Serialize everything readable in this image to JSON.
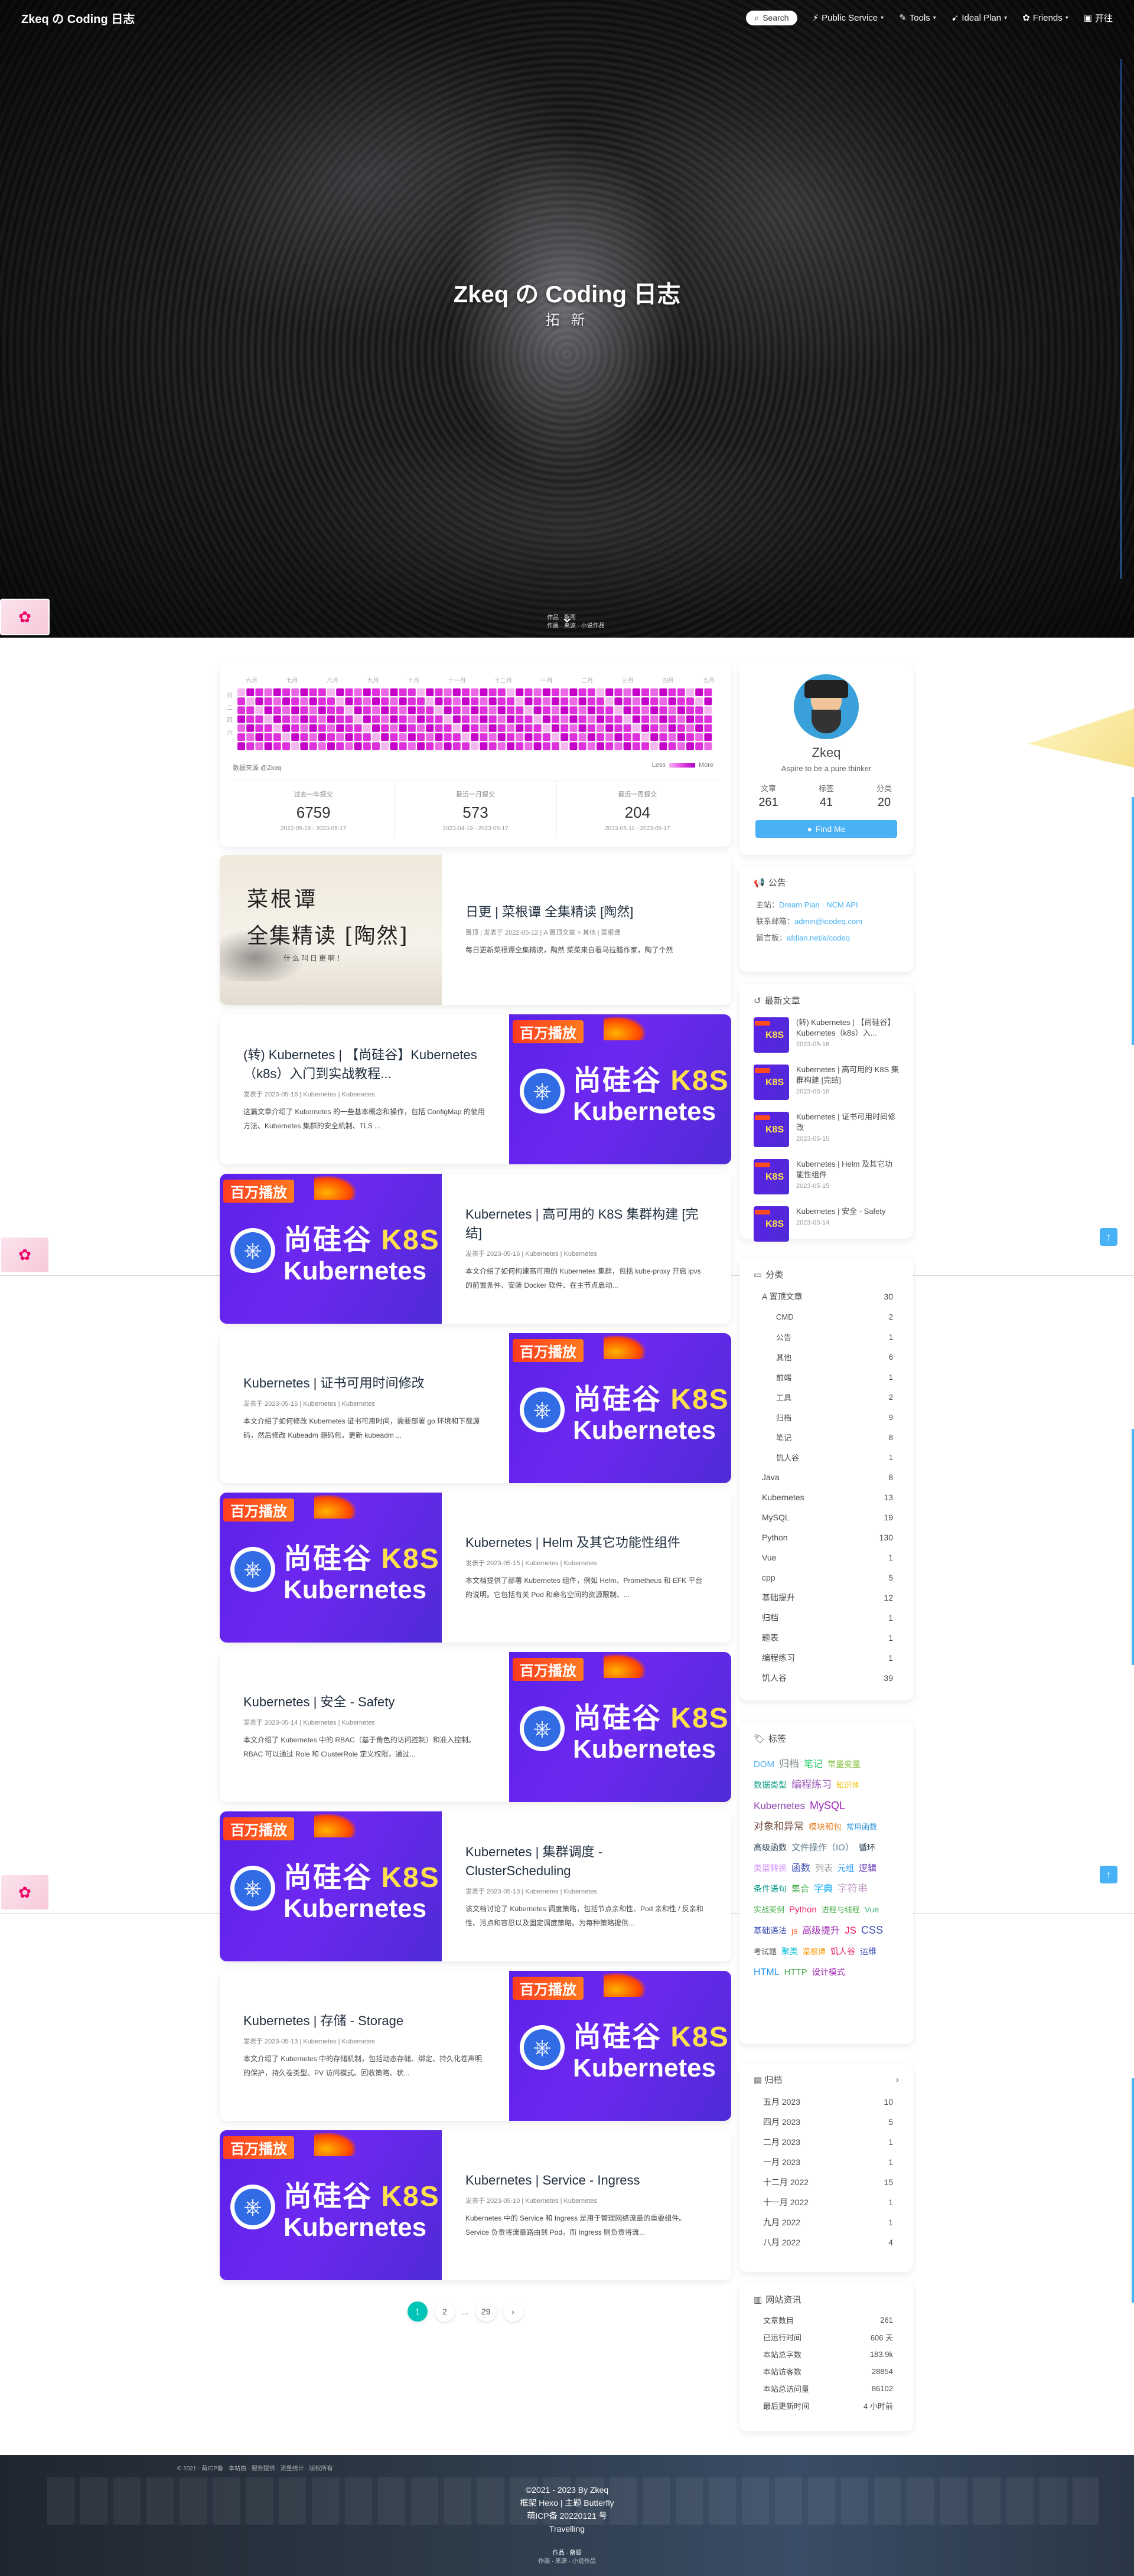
{
  "nav": {
    "title": "Zkeq の Coding 日志",
    "search_label": "Search",
    "menus": [
      "Public Service",
      "Tools",
      "Ideal Plan",
      "Friends",
      "开往"
    ]
  },
  "hero": {
    "title": "Zkeq の Coding 日志",
    "subtitle": "拓 新",
    "scroll_hint": "作品 · 蔡阁",
    "scroll_hint2": "作画 · 来源 · 小说作品"
  },
  "heatmap": {
    "months": [
      "六月",
      "七月",
      "八月",
      "九月",
      "十月",
      "十一月",
      "十二月",
      "一月",
      "二月",
      "三月",
      "四月",
      "五月"
    ],
    "weekdays": [
      "日",
      "二",
      "四",
      "六"
    ],
    "source": "数据来源 @Zkeq",
    "legend_less": "Less",
    "legend_more": "More",
    "stats": [
      {
        "label": "过去一年提交",
        "value": "6759",
        "range": "2022-05-19 - 2023-05-17"
      },
      {
        "label": "最近一月提交",
        "value": "573",
        "range": "2023-04-19 - 2023-05-17"
      },
      {
        "label": "最近一周提交",
        "value": "204",
        "range": "2023-05-11 - 2023-05-17"
      }
    ]
  },
  "posts": [
    {
      "title": "日更 | 菜根谭 全集精读 [陶然]",
      "meta": "置顶 | 发表于 2022-05-12 | A 置顶文章 > 其他 | 菜根谭",
      "excerpt": "每日更新菜根谭全集精读，陶然 菜菜来自看马拉腊作家，陶了个然"
    },
    {
      "title": "(转) Kubernetes | 【尚硅谷】Kubernetes（k8s）入门到实战教程...",
      "meta": "发表于 2023-05-16 | Kubernetes | Kubernetes",
      "excerpt": "这篇文章介绍了 Kubernetes 的一些基本概念和操作，包括 ConfigMap 的使用方法、Kubernetes 集群的安全机制、TLS ..."
    },
    {
      "title": "Kubernetes | 高可用的 K8S 集群构建 [完结]",
      "meta": "发表于 2023-05-16 | Kubernetes | Kubernetes",
      "excerpt": "本文介绍了如何构建高可用的 Kubernetes 集群，包括 kube-proxy 开启 ipvs 的前置条件、安装 Docker 软件、在主节点启动..."
    },
    {
      "title": "Kubernetes | 证书可用时间修改",
      "meta": "发表于 2023-05-15 | Kubernetes | Kubernetes",
      "excerpt": "本文介绍了如何修改 Kubernetes 证书可用时间，需要部署 go 环境和下载源码，然后修改 Kubeadm 源码包，更新 kubeadm ..."
    },
    {
      "title": "Kubernetes | Helm 及其它功能性组件",
      "meta": "发表于 2023-05-15 | Kubernetes | Kubernetes",
      "excerpt": "本文档提供了部署 Kubernetes 组件，例如 Helm、Prometheus 和 EFK 平台的说明。它包括有关 Pod 和命名空间的资源限制、..."
    },
    {
      "title": "Kubernetes | 安全 - Safety",
      "meta": "发表于 2023-05-14 | Kubernetes | Kubernetes",
      "excerpt": "本文介绍了 Kubernetes 中的 RBAC（基于角色的访问控制）和准入控制。RBAC 可以通过 Role 和 ClusterRole 定义权限，通过..."
    },
    {
      "title": "Kubernetes | 集群调度 - ClusterScheduling",
      "meta": "发表于 2023-05-13 | Kubernetes | Kubernetes",
      "excerpt": "该文档讨论了 Kubernetes 调度策略，包括节点亲和性、Pod 亲和性 / 反亲和性、污点和容忍以及固定调度策略。为每种策略提供..."
    },
    {
      "title": "Kubernetes | 存储 - Storage",
      "meta": "发表于 2023-05-13 | Kubernetes | Kubernetes",
      "excerpt": "本文介绍了 Kubernetes 中的存储机制，包括动态存储、绑定、持久化卷声明的保护，持久卷类型、PV 访问模式、回收策略、状..."
    },
    {
      "title": "Kubernetes | Service - Ingress",
      "meta": "发表于 2023-05-10 | Kubernetes | Kubernetes",
      "excerpt": "Kubernetes 中的 Service 和 Ingress 是用于管理网络流量的重要组件。Service 负责将流量路由到 Pod，而 Ingress 则负责将流..."
    }
  ],
  "k8s_thumb": {
    "badge": "百万播放",
    "line1a": "尚硅谷 ",
    "line1b": "K8S",
    "line2": "Kubernetes"
  },
  "cai_thumb": {
    "line1": "菜根谭",
    "line2": "全集精读 [陶然]",
    "line3": "什么叫日更啊！"
  },
  "pagination": {
    "pages": [
      "1",
      "2",
      "...",
      "29",
      "›"
    ]
  },
  "author": {
    "name": "Zkeq",
    "desc": "Aspire to be a pure thinker",
    "counts": [
      {
        "label": "文章",
        "value": "261"
      },
      {
        "label": "标签",
        "value": "41"
      },
      {
        "label": "分类",
        "value": "20"
      }
    ],
    "follow": "Find Me"
  },
  "announce": {
    "title": "公告",
    "lines": [
      {
        "label": "主站：",
        "value": "Dream Plan · NCM API"
      },
      {
        "label": "联系邮箱：",
        "value": "admin@icodeq.com"
      },
      {
        "label": "留言板：",
        "value": "afdian.net/a/codeq"
      }
    ]
  },
  "recent": {
    "title": "最新文章",
    "items": [
      {
        "title": "(转) Kubernetes | 【尚硅谷】Kubernetes（k8s）入...",
        "date": "2023-05-16"
      },
      {
        "title": "Kubernetes | 高可用的 K8S 集群构建 [完结]",
        "date": "2023-05-16"
      },
      {
        "title": "Kubernetes | 证书可用时间修改",
        "date": "2023-05-15"
      },
      {
        "title": "Kubernetes | Helm 及其它功能性组件",
        "date": "2023-05-15"
      },
      {
        "title": "Kubernetes | 安全 - Safety",
        "date": "2023-05-14"
      }
    ]
  },
  "categories": {
    "title": "分类",
    "items": [
      {
        "name": "A 置顶文章",
        "count": "30",
        "child": false
      },
      {
        "name": "CMD",
        "count": "2",
        "child": true
      },
      {
        "name": "公告",
        "count": "1",
        "child": true
      },
      {
        "name": "其他",
        "count": "6",
        "child": true
      },
      {
        "name": "前端",
        "count": "1",
        "child": true
      },
      {
        "name": "工具",
        "count": "2",
        "child": true
      },
      {
        "name": "归档",
        "count": "9",
        "child": true
      },
      {
        "name": "笔记",
        "count": "8",
        "child": true
      },
      {
        "name": "饥人谷",
        "count": "1",
        "child": true
      },
      {
        "name": "Java",
        "count": "8",
        "child": false
      },
      {
        "name": "Kubernetes",
        "count": "13",
        "child": false
      },
      {
        "name": "MySQL",
        "count": "19",
        "child": false
      },
      {
        "name": "Python",
        "count": "130",
        "child": false
      },
      {
        "name": "Vue",
        "count": "1",
        "child": false
      },
      {
        "name": "cpp",
        "count": "5",
        "child": false
      },
      {
        "name": "基础提升",
        "count": "12",
        "child": false
      },
      {
        "name": "归档",
        "count": "1",
        "child": false
      },
      {
        "name": "题表",
        "count": "1",
        "child": false
      },
      {
        "name": "编程练习",
        "count": "1",
        "child": false
      },
      {
        "name": "饥人谷",
        "count": "39",
        "child": false
      }
    ]
  },
  "tags": {
    "title": "标签",
    "items": [
      {
        "t": "DOM",
        "c": "#49b1f5",
        "s": "15px"
      },
      {
        "t": "归档",
        "c": "#7f8c8d",
        "s": "17px"
      },
      {
        "t": "笔记",
        "c": "#2ecc71",
        "s": "16px"
      },
      {
        "t": "常量变量",
        "c": "#8bc34a",
        "s": "14px"
      },
      {
        "t": "数据类型",
        "c": "#16a085",
        "s": "14px"
      },
      {
        "t": "编程练习",
        "c": "#9b59b6",
        "s": "17px"
      },
      {
        "t": "知识体",
        "c": "#f1c40f",
        "s": "13px"
      },
      {
        "t": "Kubernetes",
        "c": "#8e44ad",
        "s": "17px"
      },
      {
        "t": "MySQL",
        "c": "#9c27b0",
        "s": "18px"
      },
      {
        "t": "对象和异常",
        "c": "#795548",
        "s": "17px"
      },
      {
        "t": "模块和包",
        "c": "#e67e22",
        "s": "14px"
      },
      {
        "t": "常用函数",
        "c": "#3498db",
        "s": "13px"
      },
      {
        "t": "高级函数",
        "c": "#34495e",
        "s": "14px"
      },
      {
        "t": "文件操作（IO）",
        "c": "#607d8b",
        "s": "15px"
      },
      {
        "t": "循环",
        "c": "#2c3e50",
        "s": "14px"
      },
      {
        "t": "类型转换",
        "c": "#d291ff",
        "s": "14px"
      },
      {
        "t": "函数",
        "c": "#3f51b5",
        "s": "16px"
      },
      {
        "t": "列表",
        "c": "#9e9e9e",
        "s": "15px"
      },
      {
        "t": "元组",
        "c": "#2196f3",
        "s": "14px"
      },
      {
        "t": "逻辑",
        "c": "#673ab7",
        "s": "15px"
      },
      {
        "t": "条件语句",
        "c": "#009688",
        "s": "14px"
      },
      {
        "t": "集合",
        "c": "#4caf50",
        "s": "15px"
      },
      {
        "t": "字典",
        "c": "#03a9f4",
        "s": "16px"
      },
      {
        "t": "字符串",
        "c": "#c5a3c8",
        "s": "17px"
      },
      {
        "t": "实战案例",
        "c": "#4caf50",
        "s": "13px"
      },
      {
        "t": "Python",
        "c": "#e91e63",
        "s": "15px"
      },
      {
        "t": "进程与线程",
        "c": "#4caf50",
        "s": "13px"
      },
      {
        "t": "Vue",
        "c": "#42b983",
        "s": "14px"
      },
      {
        "t": "基础语法",
        "c": "#3f51b5",
        "s": "14px"
      },
      {
        "t": "js",
        "c": "#ff5722",
        "s": "14px"
      },
      {
        "t": "高级提升",
        "c": "#9c27b0",
        "s": "16px"
      },
      {
        "t": "JS",
        "c": "#e91e63",
        "s": "17px"
      },
      {
        "t": "CSS",
        "c": "#3f51b5",
        "s": "18px"
      },
      {
        "t": "考试题",
        "c": "#555555",
        "s": "13px"
      },
      {
        "t": "聚类",
        "c": "#00bcd4",
        "s": "14px"
      },
      {
        "t": "菜根谭",
        "c": "#ff9800",
        "s": "13px"
      },
      {
        "t": "饥人谷",
        "c": "#e91e63",
        "s": "14px"
      },
      {
        "t": "运维",
        "c": "#3f51b5",
        "s": "14px"
      },
      {
        "t": "HTML",
        "c": "#2196f3",
        "s": "16px"
      },
      {
        "t": "HTTP",
        "c": "#4caf50",
        "s": "15px"
      },
      {
        "t": "设计模式",
        "c": "#9c27b0",
        "s": "14px"
      }
    ]
  },
  "archives": {
    "title": "归档",
    "items": [
      {
        "m": "五月 2023",
        "c": "10"
      },
      {
        "m": "四月 2023",
        "c": "5"
      },
      {
        "m": "二月 2023",
        "c": "1"
      },
      {
        "m": "一月 2023",
        "c": "1"
      },
      {
        "m": "十二月 2022",
        "c": "15"
      },
      {
        "m": "十一月 2022",
        "c": "1"
      },
      {
        "m": "九月 2022",
        "c": "1"
      },
      {
        "m": "八月 2022",
        "c": "4"
      }
    ]
  },
  "siteinfo": {
    "title": "网站资讯",
    "items": [
      {
        "k": "文章数目",
        "v": "261"
      },
      {
        "k": "已运行时间",
        "v": "606 天"
      },
      {
        "k": "本站总字数",
        "v": "183.9k"
      },
      {
        "k": "本站访客数",
        "v": "28854"
      },
      {
        "k": "本站总访问量",
        "v": "86102"
      },
      {
        "k": "最后更新时间",
        "v": "4 小时前"
      }
    ]
  },
  "footer": {
    "line1": "©2021 - 2023 By Zkeq",
    "line2": "框架 Hexo | 主题 Butterfly",
    "line3": "萌ICP备 20220121 号",
    "line4": "Travelling",
    "hint": "作品 · 蔡阁",
    "hint2": "作画 · 来源 · 小说作品",
    "tiny": "© 2021 · 萌ICP备 · 本站由 · 服务提供 · 流量统计 · 版权所有"
  }
}
